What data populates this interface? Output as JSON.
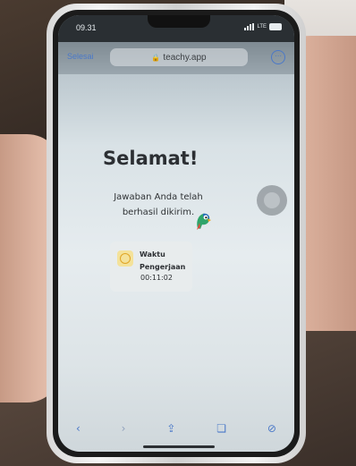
{
  "status": {
    "time": "09.31",
    "network": "LTE"
  },
  "browser": {
    "done_label": "Selesai",
    "url": "teachy.app",
    "more_glyph": "⋯"
  },
  "content": {
    "title": "Selamat!",
    "message": "Jawaban Anda telah berhasil dikirim.",
    "time_card": {
      "label_line1": "Waktu",
      "label_line2": "Pengerjaan",
      "value": "00:11:02"
    }
  },
  "toolbar": [
    {
      "name": "back-icon",
      "glyph": "‹"
    },
    {
      "name": "forward-icon",
      "glyph": "›"
    },
    {
      "name": "share-icon",
      "glyph": "⇪"
    },
    {
      "name": "bookmarks-icon",
      "glyph": "❏"
    },
    {
      "name": "tabs-icon",
      "glyph": "⊘"
    }
  ],
  "colors": {
    "accent": "#4a78c8",
    "clock_badge": "#f4e29a",
    "clock_ring": "#e0a526"
  }
}
